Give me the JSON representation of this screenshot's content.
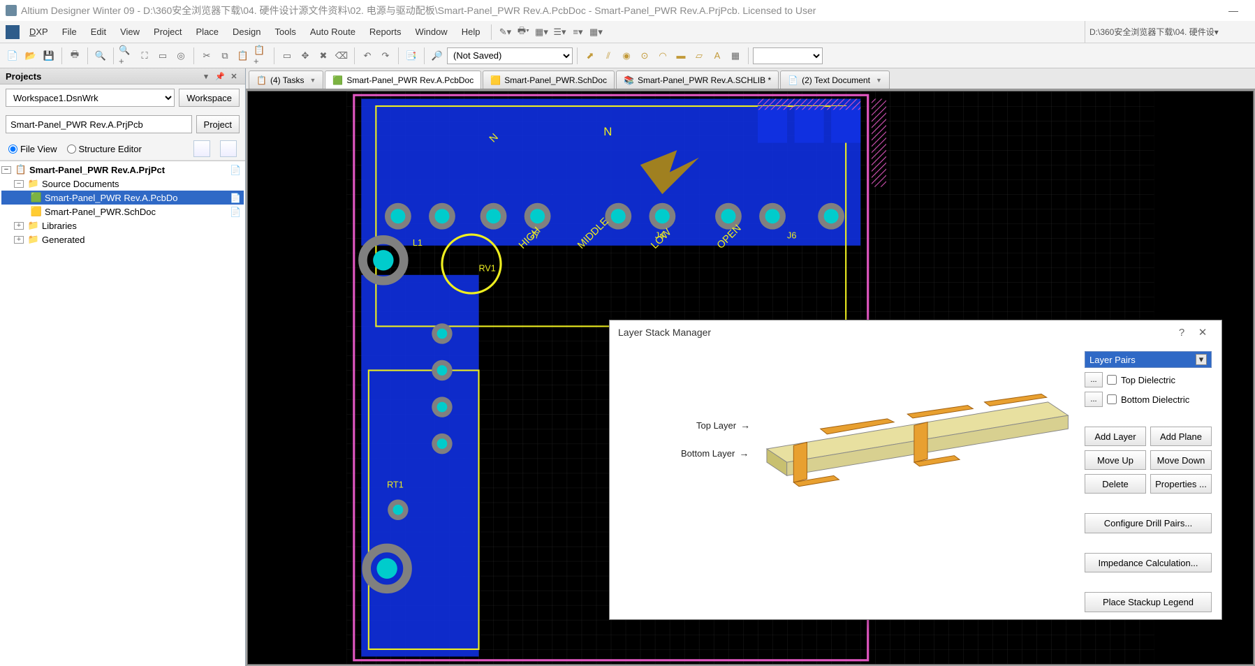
{
  "titlebar": {
    "text": "Altium Designer Winter 09 - D:\\360安全浏览器下载\\04. 硬件设计源文件资料\\02. 电源与驱动配板\\Smart-Panel_PWR Rev.A.PcbDoc - Smart-Panel_PWR Rev.A.PrjPcb. Licensed to User"
  },
  "menu": {
    "dxp": "DXP",
    "file": "File",
    "edit": "Edit",
    "view": "View",
    "project": "Project",
    "place": "Place",
    "design": "Design",
    "tools": "Tools",
    "autoroute": "Auto Route",
    "reports": "Reports",
    "window": "Window",
    "help": "Help",
    "path": "D:\\360安全浏览器下载\\04. 硬件设"
  },
  "toolbar": {
    "saved_state": "(Not Saved)"
  },
  "projects": {
    "title": "Projects",
    "workspace_value": "Workspace1.DsnWrk",
    "workspace_btn": "Workspace",
    "project_value": "Smart-Panel_PWR Rev.A.PrjPcb",
    "project_btn": "Project",
    "file_view": "File View",
    "structure_editor": "Structure Editor",
    "tree": {
      "root": "Smart-Panel_PWR Rev.A.PrjPct",
      "src": "Source Documents",
      "pcb": "Smart-Panel_PWR Rev.A.PcbDo",
      "sch": "Smart-Panel_PWR.SchDoc",
      "lib": "Libraries",
      "gen": "Generated"
    }
  },
  "doctabs": {
    "tasks": "(4) Tasks",
    "pcb": "Smart-Panel_PWR Rev.A.PcbDoc",
    "sch": "Smart-Panel_PWR.SchDoc",
    "schlib": "Smart-Panel_PWR Rev.A.SCHLIB *",
    "text": "(2) Text Document"
  },
  "dialog": {
    "title": "Layer Stack Manager",
    "top_layer": "Top Layer",
    "bottom_layer": "Bottom Layer",
    "combo": "Layer Pairs",
    "top_dielectric": "Top Dielectric",
    "bottom_dielectric": "Bottom Dielectric",
    "dots": "...",
    "add_layer": "Add Layer",
    "add_plane": "Add Plane",
    "move_up": "Move Up",
    "move_down": "Move Down",
    "delete": "Delete",
    "properties": "Properties ...",
    "configure_drill": "Configure Drill Pairs...",
    "impedance": "Impedance Calculation...",
    "stackup_legend": "Place Stackup Legend"
  }
}
